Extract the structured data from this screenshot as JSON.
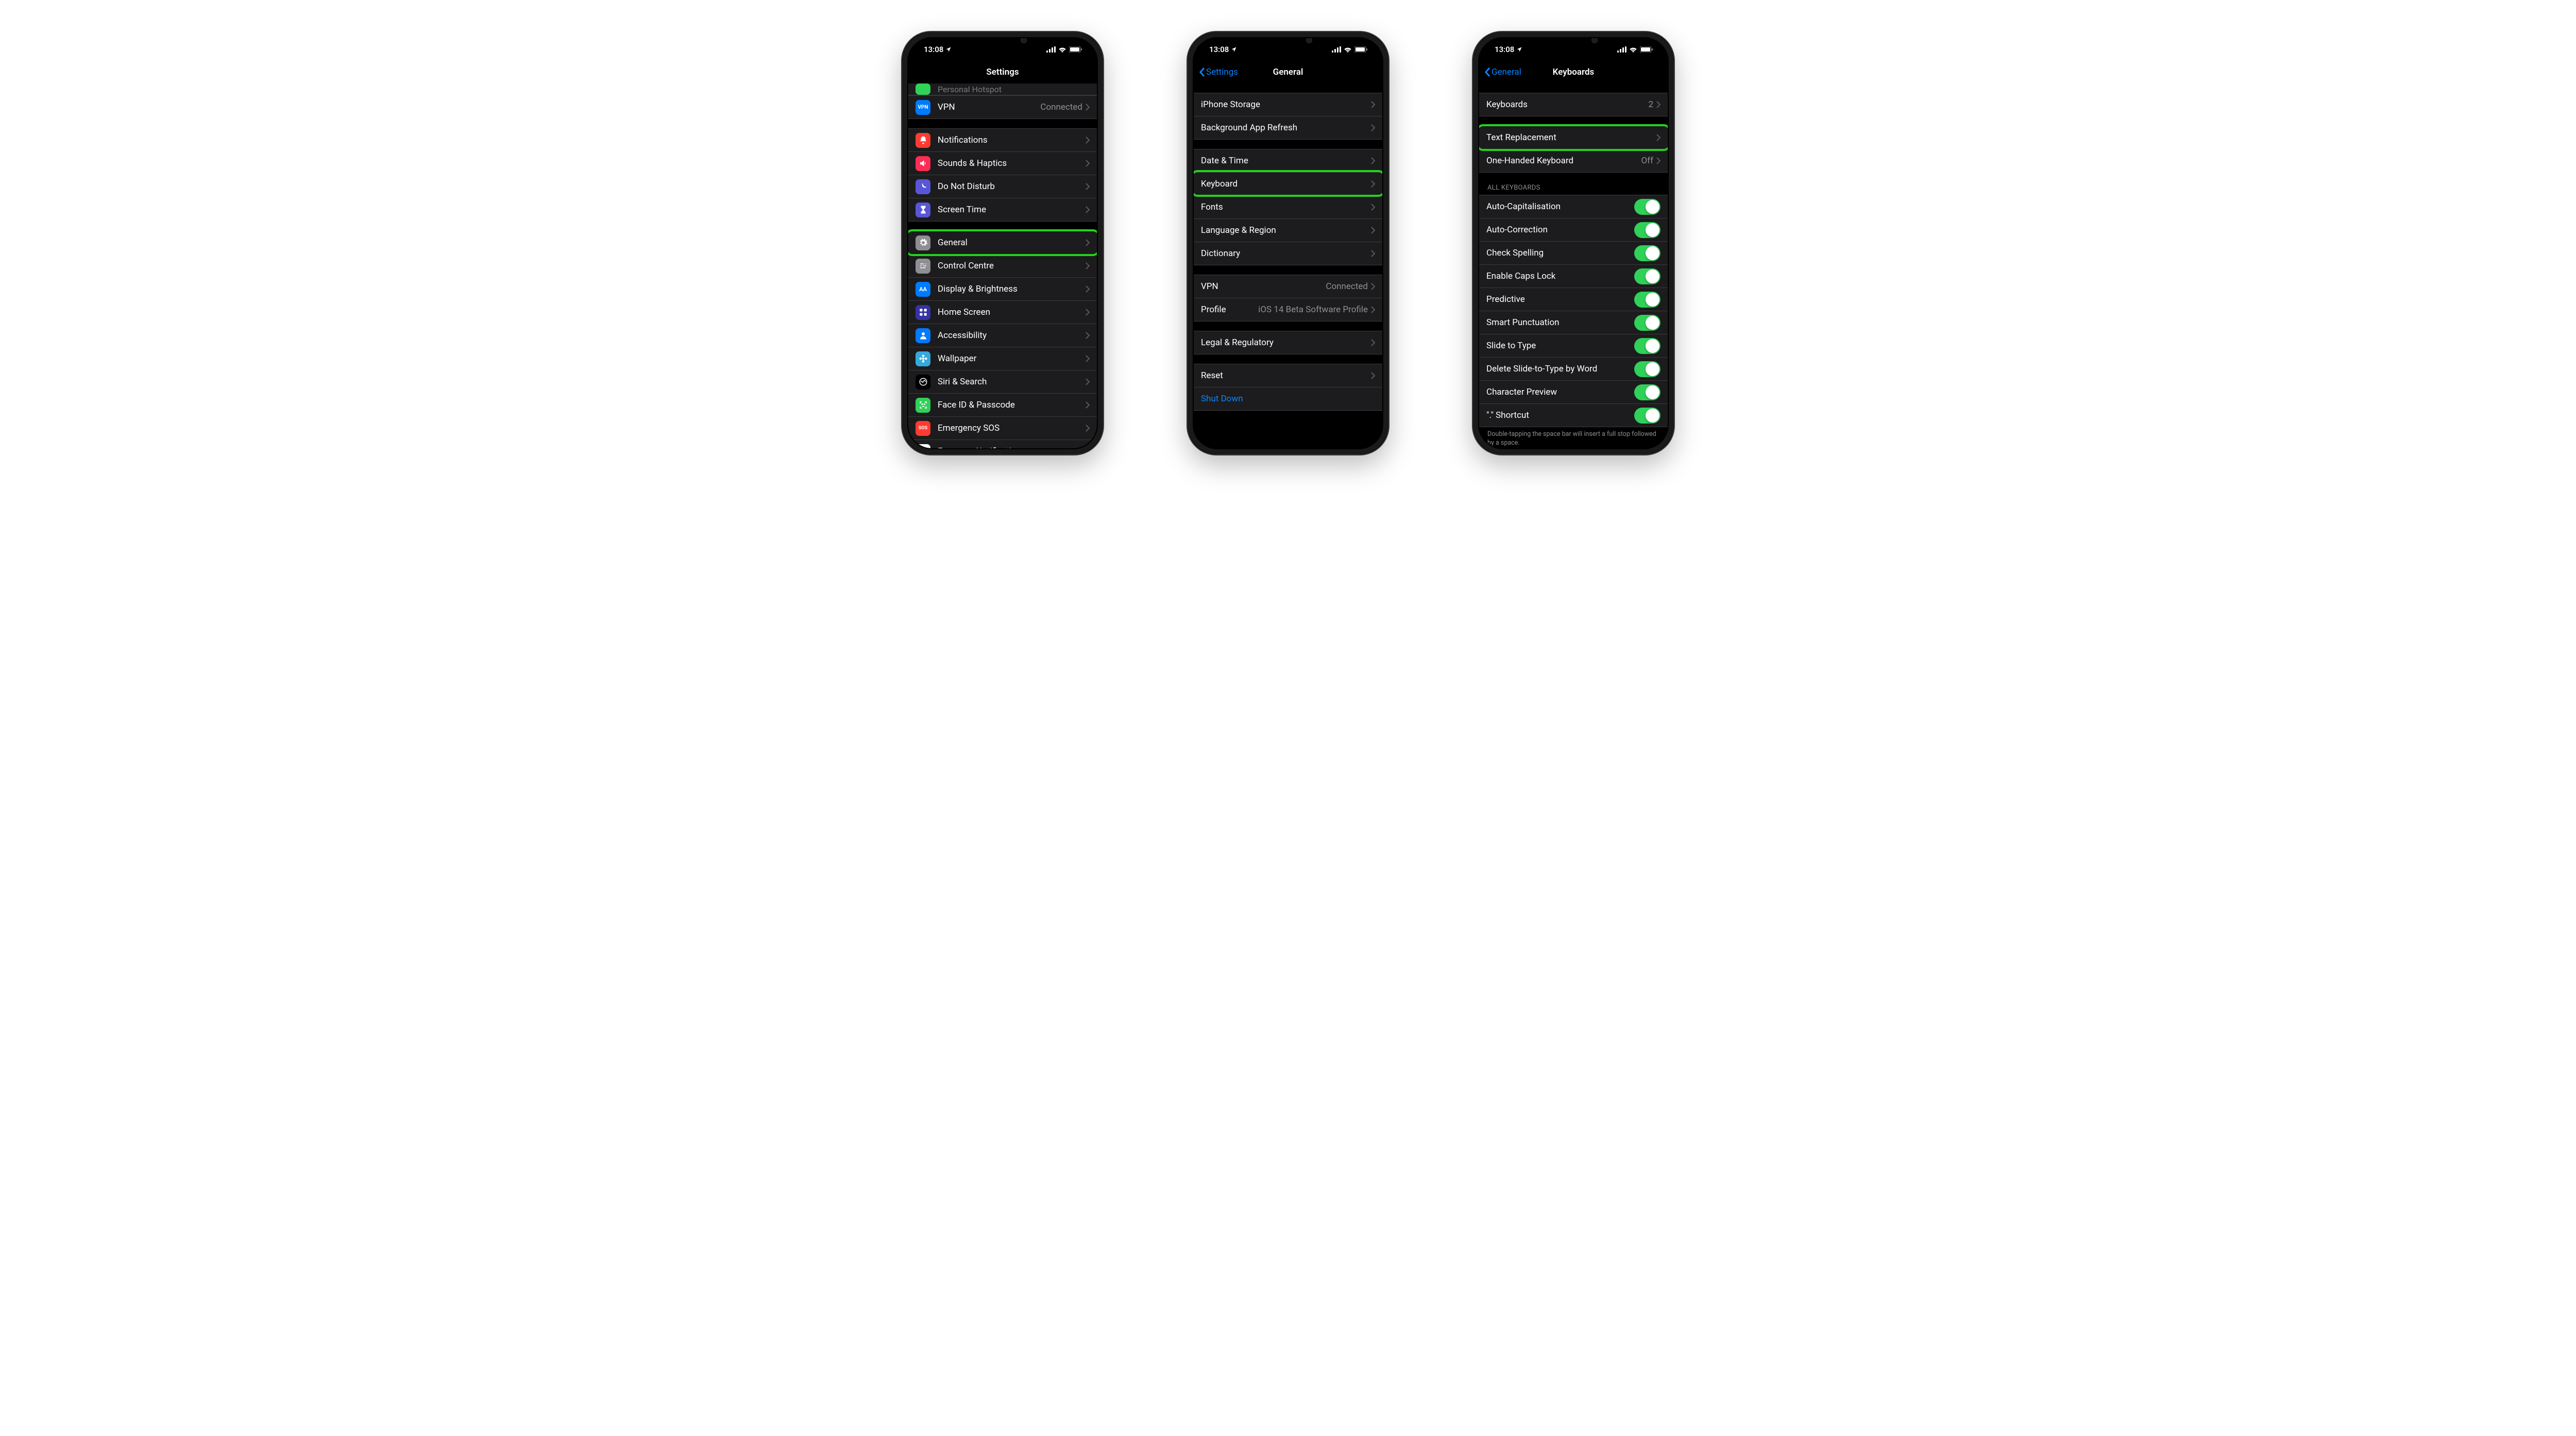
{
  "status": {
    "time": "13:08"
  },
  "phones": {
    "settings": {
      "title": "Settings",
      "partial_row": {
        "label": "Personal Hotspot"
      },
      "rows_a": [
        {
          "icon_bg": "#007aff",
          "icon_text": "VPN",
          "label": "VPN",
          "detail": "Connected"
        }
      ],
      "rows_b": [
        {
          "icon_bg": "#ff3b30",
          "glyph": "bell",
          "label": "Notifications"
        },
        {
          "icon_bg": "#ff2d55",
          "glyph": "speaker",
          "label": "Sounds & Haptics"
        },
        {
          "icon_bg": "#5856d6",
          "glyph": "moon",
          "label": "Do Not Disturb"
        },
        {
          "icon_bg": "#5856d6",
          "glyph": "hourglass",
          "label": "Screen Time"
        }
      ],
      "rows_c": [
        {
          "icon_bg": "#8e8e93",
          "glyph": "gear",
          "label": "General",
          "highlighted": true
        },
        {
          "icon_bg": "#8e8e93",
          "glyph": "sliders",
          "label": "Control Centre"
        },
        {
          "icon_bg": "#007aff",
          "icon_text": "AA",
          "label": "Display & Brightness"
        },
        {
          "icon_bg": "#3634a3",
          "glyph": "grid",
          "label": "Home Screen"
        },
        {
          "icon_bg": "#007aff",
          "glyph": "person",
          "label": "Accessibility"
        },
        {
          "icon_bg": "#34aadc",
          "glyph": "flower",
          "label": "Wallpaper"
        },
        {
          "icon_bg": "#000000",
          "glyph": "siri",
          "label": "Siri & Search"
        },
        {
          "icon_bg": "#30d158",
          "glyph": "faceid",
          "label": "Face ID & Passcode"
        },
        {
          "icon_bg": "#ff3b30",
          "icon_text": "SOS",
          "label": "Emergency SOS"
        },
        {
          "icon_bg": "#ffffff",
          "glyph": "exposure",
          "label": "Exposure Notifications"
        }
      ]
    },
    "general": {
      "back": "Settings",
      "title": "General",
      "group1": [
        {
          "label": "iPhone Storage"
        },
        {
          "label": "Background App Refresh"
        }
      ],
      "group2": [
        {
          "label": "Date & Time"
        },
        {
          "label": "Keyboard",
          "highlighted": true
        },
        {
          "label": "Fonts"
        },
        {
          "label": "Language & Region"
        },
        {
          "label": "Dictionary"
        }
      ],
      "group3": [
        {
          "label": "VPN",
          "detail": "Connected"
        },
        {
          "label": "Profile",
          "detail": "iOS 14 Beta Software Profile"
        }
      ],
      "group4": [
        {
          "label": "Legal & Regulatory"
        }
      ],
      "group5": [
        {
          "label": "Reset"
        },
        {
          "label": "Shut Down",
          "link": true,
          "no_chevron": true
        }
      ]
    },
    "keyboards": {
      "back": "General",
      "title": "Keyboards",
      "group1": [
        {
          "label": "Keyboards",
          "detail": "2"
        }
      ],
      "group2": [
        {
          "label": "Text Replacement",
          "highlighted": true
        },
        {
          "label": "One-Handed Keyboard",
          "detail": "Off"
        }
      ],
      "section_header": "ALL KEYBOARDS",
      "toggles": [
        {
          "label": "Auto-Capitalisation",
          "on": true
        },
        {
          "label": "Auto-Correction",
          "on": true
        },
        {
          "label": "Check Spelling",
          "on": true
        },
        {
          "label": "Enable Caps Lock",
          "on": true
        },
        {
          "label": "Predictive",
          "on": true
        },
        {
          "label": "Smart Punctuation",
          "on": true
        },
        {
          "label": "Slide to Type",
          "on": true
        },
        {
          "label": "Delete Slide-to-Type by Word",
          "on": true
        },
        {
          "label": "Character Preview",
          "on": true
        },
        {
          "label": "\".\" Shortcut",
          "on": true
        }
      ],
      "footer": "Double-tapping the space bar will insert a full stop followed by a space."
    }
  }
}
